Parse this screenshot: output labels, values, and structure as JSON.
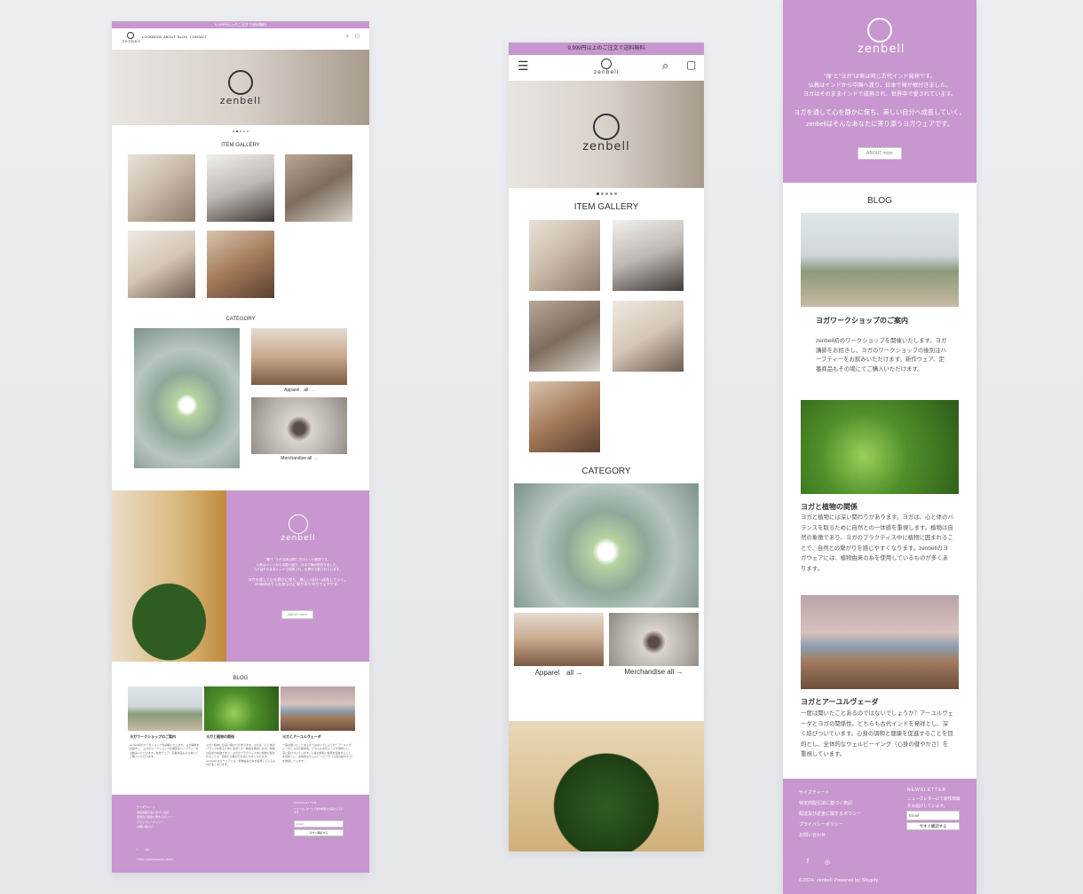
{
  "brand": {
    "name": "zenbell",
    "accent": "#c897cf"
  },
  "announcement": "9,999円以上のご注文で送料無料",
  "nav": [
    "LOOKBOOK",
    "ABOUT",
    "BLOG",
    "CONTACT"
  ],
  "icons": {
    "search": "search-icon",
    "cart": "cart-icon",
    "menu": "hamburger-icon",
    "facebook": "facebook-icon",
    "instagram": "instagram-icon"
  },
  "sections": {
    "gallery": "ITEM GALLERY",
    "category": "CATEGORY",
    "blog": "BLOG"
  },
  "category_links": {
    "apparel": "Apparel　all →",
    "merch": "Merchandise all →"
  },
  "about": {
    "line1": "\"禅\"と\"ヨガ\"は実は同じ古代インド発祥です。",
    "line2": "仏教はインドから中国へ渡り、日本で禅が根付きました。",
    "line3": "ヨガはそのままインドで成熟され、世界中で愛されています。",
    "line4": "ヨガを通して心を静かに保ち、美しい自分へ成長していく。",
    "line5": "zenbellはそんなあなたに寄り添うヨガウェアです。",
    "button": "ABOUT more"
  },
  "blog_posts": [
    {
      "title": "ヨガワークショップのご案内",
      "body": "zenbell初のワークショップを開催いたします。ヨガ講師をお招きし、ヨガのワークショップの後別注ハーブティーをお飲みいただけます。新作ウェア、定番商品もその場にてご購入いただけます。"
    },
    {
      "title": "ヨガと植物の関係",
      "body": "ヨガと植物には深い関わりがあります。ヨガは、心と体のバランスを取るために自然との一体感を重視します。植物は自然の象徴であり、ヨガのプラクティス中に植物に囲まれることで、自然との繋がりを感じやすくなります。zenbellのヨガウェアには、植物由来の糸を使用しているものが多くあります。"
    },
    {
      "title": "ヨガとアーユルヴェーダ",
      "body": "一度は聞いたことあるのではないでしょうか？アーユルヴェーダとヨガの関係性。どちらも古代インドを発祥とし、深く結びついています。心身の調和と健康を促進することを目的とし、全体的なウェルビーイング（心身の健やかさ）を重視しています。"
    }
  ],
  "footer": {
    "links": [
      "サイズチャート",
      "特定商取引法に基づく表記",
      "配送及び返金に関するポリシー",
      "プライバシーポリシー",
      "お問い合わせ"
    ],
    "newsletter_title": "NEWSLETTER",
    "newsletter_text": "ニュースレターにて新作情報をお届けしています。",
    "email_placeholder": "Email",
    "subscribe": "今すぐ購読する",
    "copyright": "©2024- zenbell  Powered by Shopify"
  }
}
